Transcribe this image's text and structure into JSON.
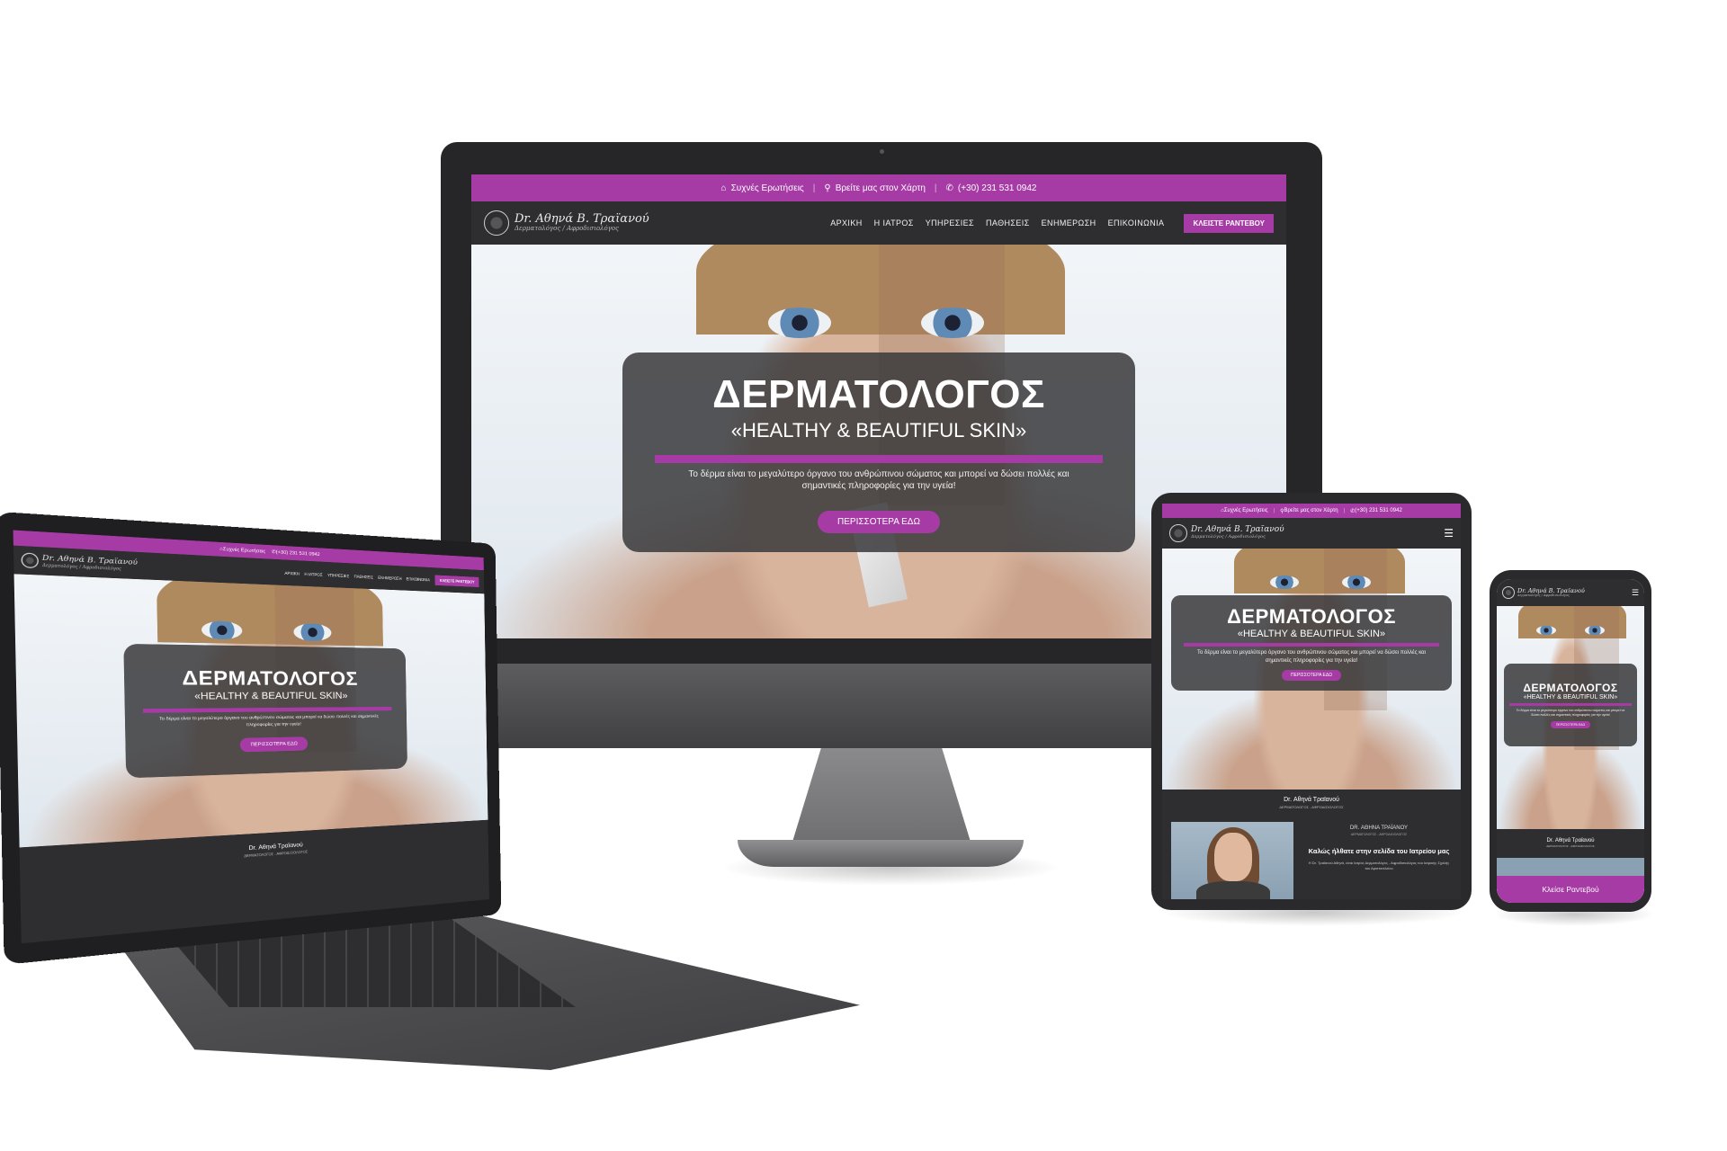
{
  "site": {
    "logo_name": "Dr. Αθηνά Β. Τραϊανού",
    "logo_tagline": "Δερματολόγος / Αφροδισιολόγος",
    "topbar": {
      "faq": "Συχνές Ερωτήσεις",
      "map": "Βρείτε μας στον Χάρτη",
      "phone": "(+30) 231 531 0942"
    },
    "menu": [
      "ΑΡΧΙΚΗ",
      "Η ΙΑΤΡΟΣ",
      "ΥΠΗΡΕΣΙΕΣ",
      "ΠΑΘΗΣΕΙΣ",
      "ΕΝΗΜΕΡΩΣΗ",
      "ΕΠΙΚΟΙΝΩΝΙΑ"
    ],
    "cta": "ΚΛΕΙΣΤΕ ΡΑΝΤΕΒΟΥ",
    "hero": {
      "title": "ΔΕΡΜΑΤΟΛΟΓΟΣ",
      "subtitle": "«HEALTHY & BEAUTIFUL SKIN»",
      "text": "Το δέρμα είναι το μεγαλύτερο όργανο του ανθρώπινου σώματος και μπορεί να δώσει πολλές και σημαντικές πληροφορίες για την υγεία!",
      "button": "ΠΕΡΙΣΣΟΤΕΡΑ ΕΔΩ"
    },
    "doctor_band": {
      "name": "Dr. Αθηνά Τραϊανού",
      "role": "ΔΕΡΜΑΤΟΛΟΓΟΣ - ΑΦΡΟΔΙΣΙΟΛΟΓΟΣ"
    },
    "welcome": {
      "name_caps": "DR. ΑΘΗΝΑ ΤΡΑΪΑΝΟΥ",
      "role": "ΔΕΡΜΑΤΟΛΟΓΟΣ - ΑΦΡΟΔΙΣΙΟΛΟΓΟΣ",
      "heading": "Καλώς ήλθατε στην σελίδα του Ιατρείου μας",
      "text": "Η Dr. Τραϊανού Αθηνά, είναι Ιατρός Δερματολόγος - Αφροδισιολόγος του Ιατρικής Σχολής του Αριστοτελείου"
    },
    "mobile_book": "Κλείσε Ραντεβού"
  },
  "colors": {
    "accent": "#a63ba6",
    "dark": "#2e2e30",
    "hero_box": "#3a3a3c"
  },
  "icons": {
    "faq": "home-icon",
    "map": "map-pin-icon",
    "phone": "phone-icon",
    "menu": "hamburger-icon"
  }
}
